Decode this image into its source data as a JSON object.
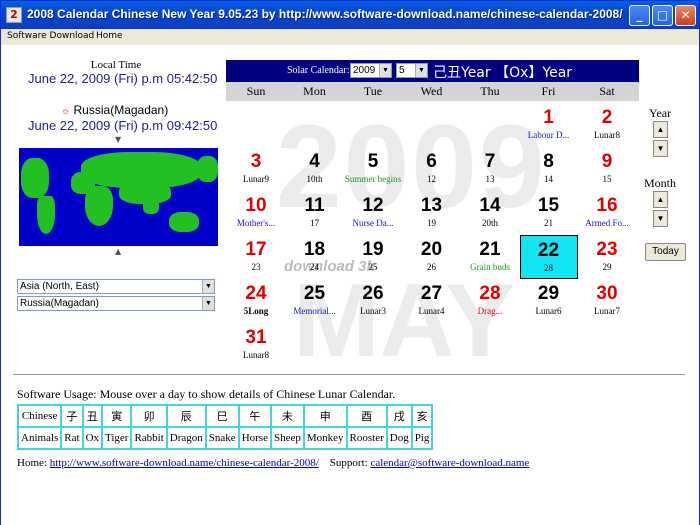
{
  "window": {
    "title": "2008 Calendar Chinese New Year  9.05.23  by  http://www.software-download.name/chinese-calendar-2008/",
    "icon": "2"
  },
  "menu": [
    "Software Download",
    "Home"
  ],
  "local": {
    "label": "Local Time",
    "time": "June 22, 2009 (Fri) p.m 05:42:50"
  },
  "remote": {
    "label": "Russia(Magadan)",
    "time": "June 22, 2009 (Fri) p.m 09:42:50"
  },
  "selects": {
    "region": "Asia (North, East)",
    "city": "Russia(Magadan)"
  },
  "calendar": {
    "solar_label": "Solar Calendar:",
    "year": "2009",
    "month": "5",
    "heading": "己丑Year 【Ox】Year",
    "weekdays": [
      "Sun",
      "Mon",
      "Tue",
      "Wed",
      "Thu",
      "Fri",
      "Sat"
    ],
    "watermark_year": "2009",
    "watermark_month": "MAY",
    "watermark_site": "download 3k",
    "days": [
      {
        "d": "1",
        "s": "Labour D...",
        "col": 5,
        "row": 0,
        "c": "red",
        "sc": "blue"
      },
      {
        "d": "2",
        "s": "Lunar8",
        "col": 6,
        "row": 0,
        "c": "red",
        "sc": "black"
      },
      {
        "d": "3",
        "s": "Lunar9",
        "col": 0,
        "row": 1,
        "c": "red",
        "sc": "black"
      },
      {
        "d": "4",
        "s": "10th",
        "col": 1,
        "row": 1,
        "c": "black",
        "sc": "black"
      },
      {
        "d": "5",
        "s": "Summer begins",
        "col": 2,
        "row": 1,
        "c": "black",
        "sc": "green"
      },
      {
        "d": "6",
        "s": "12",
        "col": 3,
        "row": 1,
        "c": "black",
        "sc": "black"
      },
      {
        "d": "7",
        "s": "13",
        "col": 4,
        "row": 1,
        "c": "black",
        "sc": "black"
      },
      {
        "d": "8",
        "s": "14",
        "col": 5,
        "row": 1,
        "c": "black",
        "sc": "black"
      },
      {
        "d": "9",
        "s": "15",
        "col": 6,
        "row": 1,
        "c": "red",
        "sc": "black"
      },
      {
        "d": "10",
        "s": "Mother's...",
        "col": 0,
        "row": 2,
        "c": "red",
        "sc": "blue"
      },
      {
        "d": "11",
        "s": "17",
        "col": 1,
        "row": 2,
        "c": "black",
        "sc": "black"
      },
      {
        "d": "12",
        "s": "Nurse Da...",
        "col": 2,
        "row": 2,
        "c": "black",
        "sc": "blue"
      },
      {
        "d": "13",
        "s": "19",
        "col": 3,
        "row": 2,
        "c": "black",
        "sc": "black"
      },
      {
        "d": "14",
        "s": "20th",
        "col": 4,
        "row": 2,
        "c": "black",
        "sc": "black"
      },
      {
        "d": "15",
        "s": "21",
        "col": 5,
        "row": 2,
        "c": "black",
        "sc": "black"
      },
      {
        "d": "16",
        "s": "Armed Fo...",
        "col": 6,
        "row": 2,
        "c": "red",
        "sc": "blue"
      },
      {
        "d": "17",
        "s": "23",
        "col": 0,
        "row": 3,
        "c": "red",
        "sc": "black"
      },
      {
        "d": "18",
        "s": "24",
        "col": 1,
        "row": 3,
        "c": "black",
        "sc": "black"
      },
      {
        "d": "19",
        "s": "25",
        "col": 2,
        "row": 3,
        "c": "black",
        "sc": "black"
      },
      {
        "d": "20",
        "s": "26",
        "col": 3,
        "row": 3,
        "c": "black",
        "sc": "black"
      },
      {
        "d": "21",
        "s": "Grain buds",
        "col": 4,
        "row": 3,
        "c": "black",
        "sc": "green"
      },
      {
        "d": "22",
        "s": "28",
        "col": 5,
        "row": 3,
        "c": "black",
        "sc": "black",
        "today": true
      },
      {
        "d": "23",
        "s": "29",
        "col": 6,
        "row": 3,
        "c": "red",
        "sc": "black"
      },
      {
        "d": "24",
        "s": "5Long",
        "col": 0,
        "row": 4,
        "c": "red",
        "sc": "black",
        "bold": true
      },
      {
        "d": "25",
        "s": "Memorial...",
        "col": 1,
        "row": 4,
        "c": "black",
        "sc": "blue"
      },
      {
        "d": "26",
        "s": "Lunar3",
        "col": 2,
        "row": 4,
        "c": "black",
        "sc": "black"
      },
      {
        "d": "27",
        "s": "Lunar4",
        "col": 3,
        "row": 4,
        "c": "black",
        "sc": "black"
      },
      {
        "d": "28",
        "s": "Drag...",
        "col": 4,
        "row": 4,
        "c": "red",
        "sc": "red"
      },
      {
        "d": "29",
        "s": "Lunar6",
        "col": 5,
        "row": 4,
        "c": "black",
        "sc": "black"
      },
      {
        "d": "30",
        "s": "Lunar7",
        "col": 6,
        "row": 4,
        "c": "red",
        "sc": "black"
      },
      {
        "d": "31",
        "s": "Lunar8",
        "col": 0,
        "row": 5,
        "c": "red",
        "sc": "black"
      }
    ]
  },
  "spinners": {
    "year_label": "Year",
    "month_label": "Month",
    "up": "▲",
    "down": "▼",
    "today_label": "Today"
  },
  "usage": "Software Usage: Mouse over a day to show details of Chinese Lunar Calendar.",
  "zodiac": {
    "chinese_label": "Chinese",
    "animals_label": "Animals",
    "chars": [
      "子",
      "丑",
      "寅",
      "卯",
      "辰",
      "巳",
      "午",
      "未",
      "申",
      "酉",
      "戌",
      "亥"
    ],
    "animals": [
      "Rat",
      "Ox",
      "Tiger",
      "Rabbit",
      "Dragon",
      "Snake",
      "Horse",
      "Sheep",
      "Monkey",
      "Rooster",
      "Dog",
      "Pig"
    ]
  },
  "footer": {
    "home_label": "Home:",
    "home_url": "http://www.software-download.name/chinese-calendar-2008/",
    "support_label": "Support:",
    "support_email": "calendar@software-download.name"
  },
  "colors": {
    "title_bar": "#0347d4",
    "calendar_header": "#000080",
    "today_highlight": "#13e4f3",
    "zodiac_border": "#40d8d8",
    "map_ocean": "#0000c8",
    "map_land": "#22c022"
  }
}
